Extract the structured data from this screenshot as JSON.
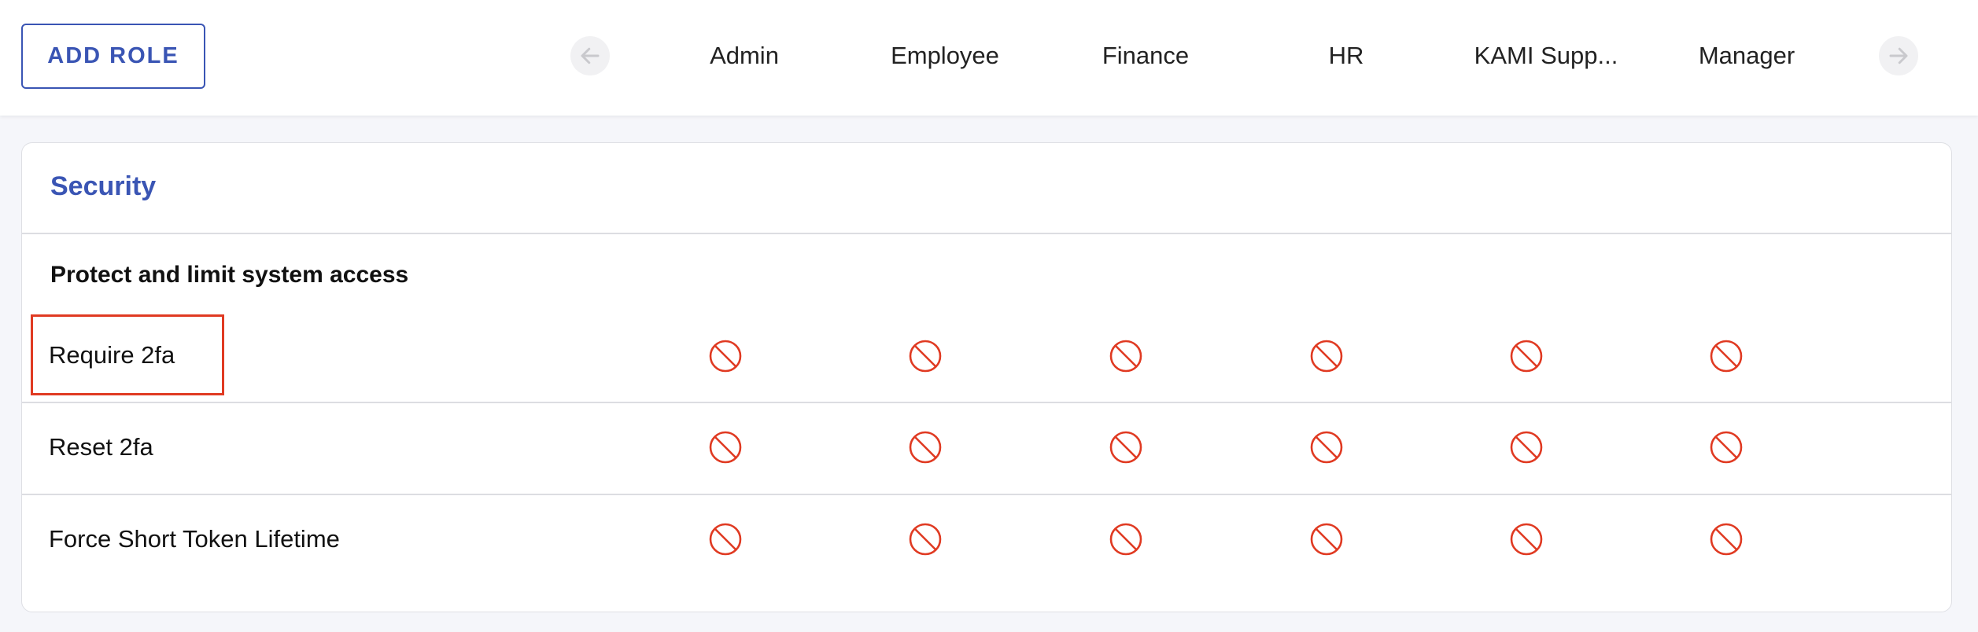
{
  "toolbar": {
    "add_role_label": "ADD ROLE"
  },
  "roles": [
    {
      "label": "Admin"
    },
    {
      "label": "Employee"
    },
    {
      "label": "Finance"
    },
    {
      "label": "HR"
    },
    {
      "label": "KAMI Supp..."
    },
    {
      "label": "Manager"
    }
  ],
  "section": {
    "title": "Security",
    "subheading": "Protect and limit system access",
    "permissions": [
      {
        "label": "Require 2fa",
        "values": [
          "denied",
          "denied",
          "denied",
          "denied",
          "denied",
          "denied"
        ]
      },
      {
        "label": "Reset 2fa",
        "values": [
          "denied",
          "denied",
          "denied",
          "denied",
          "denied",
          "denied"
        ]
      },
      {
        "label": "Force Short Token Lifetime",
        "values": [
          "denied",
          "denied",
          "denied",
          "denied",
          "denied",
          "denied"
        ]
      }
    ]
  },
  "icons": {
    "denied": "prohibited-icon",
    "prev": "arrow-left-icon",
    "next": "arrow-right-icon"
  },
  "colors": {
    "accent": "#3a55b4",
    "denied": "#e03a22",
    "highlight": "#e03a22"
  }
}
